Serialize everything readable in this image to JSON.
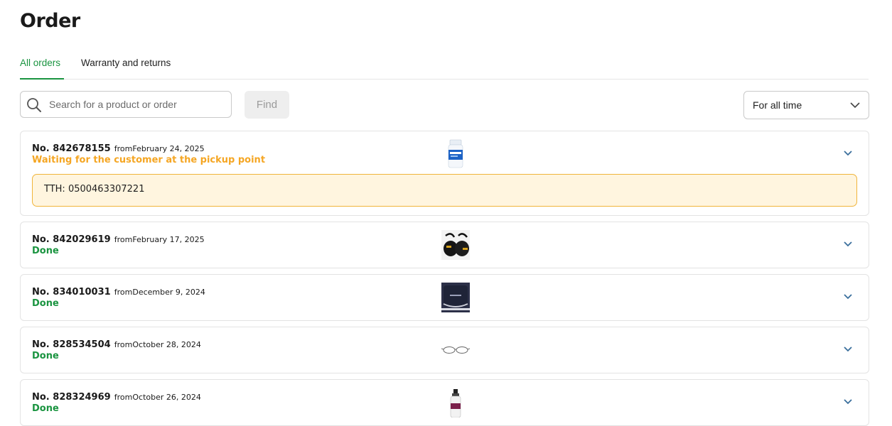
{
  "page": {
    "title": "Order"
  },
  "tabs": [
    {
      "label": "All orders",
      "active": true
    },
    {
      "label": "Warranty and returns",
      "active": false
    }
  ],
  "search": {
    "placeholder": "Search for a product or order",
    "value": "",
    "icon": "search-icon"
  },
  "find_button": {
    "label": "Find"
  },
  "period_filter": {
    "selected": "For all time",
    "icon": "chevron-down-icon"
  },
  "colors": {
    "accent": "#1a9440",
    "waiting": "#f5a623",
    "note_bg": "#fff5df",
    "note_border": "#f0b43a"
  },
  "orders": [
    {
      "number": "No. 842678155",
      "from": "fromFebruary 24, 2025",
      "status": "Waiting for the customer at the pickup point",
      "status_type": "waiting",
      "note": "TTH: 0500463307221",
      "thumbnail": "medicine-bottle"
    },
    {
      "number": "No. 842029619",
      "from": "fromFebruary 17, 2025",
      "status": "Done",
      "status_type": "done",
      "thumbnail": "black-gloves"
    },
    {
      "number": "No. 834010031",
      "from": "fromDecember 9, 2024",
      "status": "Done",
      "status_type": "done",
      "thumbnail": "navy-bag"
    },
    {
      "number": "No. 828534504",
      "from": "fromOctober 28, 2024",
      "status": "Done",
      "status_type": "done",
      "thumbnail": "eyeglasses"
    },
    {
      "number": "No. 828324969",
      "from": "fromOctober 26, 2024",
      "status": "Done",
      "status_type": "done",
      "thumbnail": "spray-bottle"
    }
  ]
}
